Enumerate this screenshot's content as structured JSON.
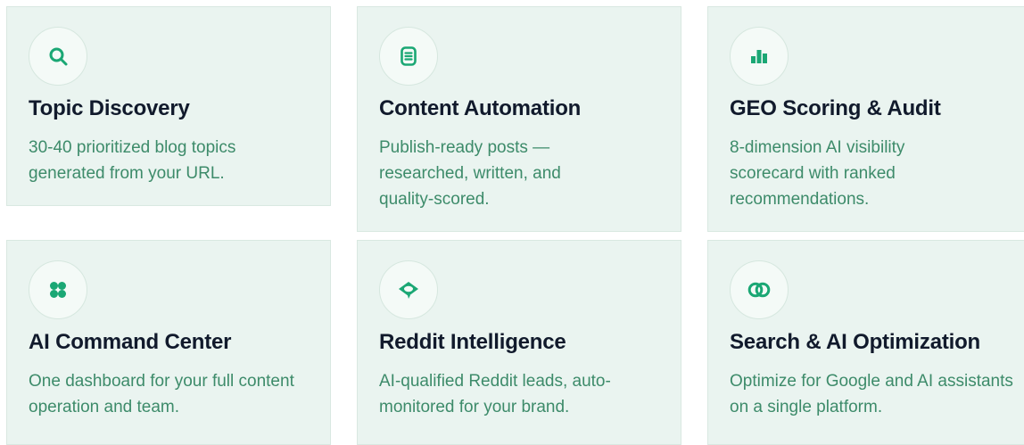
{
  "accent_color": "#1aa774",
  "features": [
    {
      "icon": "search-icon",
      "title": "Topic Discovery",
      "description": "30-40 prioritized blog topics generated from your URL."
    },
    {
      "icon": "document-icon",
      "title": "Content Automation",
      "description": "Publish-ready posts — researched, written, and quality-scored."
    },
    {
      "icon": "bar-chart-icon",
      "title": "GEO Scoring & Audit",
      "description": "8-dimension AI visibility scorecard with ranked recommendations."
    },
    {
      "icon": "four-dots-icon",
      "title": "AI Command Center",
      "description": "One dashboard for your full content operation and team."
    },
    {
      "icon": "eye-icon",
      "title": "Reddit Intelligence",
      "description": "AI-qualified Reddit leads, auto-monitored for your brand."
    },
    {
      "icon": "linked-rings-icon",
      "title": "Search & AI Optimization",
      "description": "Optimize for Google and AI assistants on a single platform."
    }
  ]
}
